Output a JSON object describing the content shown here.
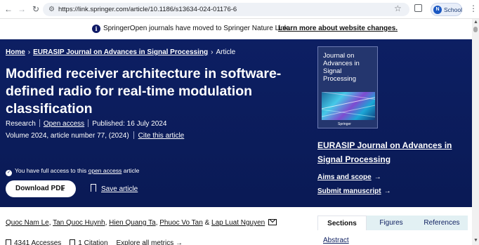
{
  "browser": {
    "url": "https://link.springer.com/article/10.1186/s13634-024-01176-6",
    "profile_initial": "N",
    "profile_label": "School"
  },
  "notice": {
    "text": "SpringerOpen journals have moved to Springer Nature Link.",
    "link": "Learn more about website changes."
  },
  "breadcrumb": {
    "home": "Home",
    "journal": "EURASIP Journal on Advances in Signal Processing",
    "current": "Article"
  },
  "article": {
    "title": "Modified receiver architecture in software-defined radio for real-time modulation classification",
    "type": "Research",
    "access": "Open access",
    "published": "Published: 16 July 2024",
    "volume": "Volume 2024, article number 77, (2024)",
    "cite": "Cite this article",
    "access_note_prefix": "You have full access to this",
    "access_note_link": "open access",
    "access_note_suffix": "article",
    "download_label": "Download PDF",
    "save_label": "Save article"
  },
  "journal": {
    "cover_line1": "Journal on",
    "cover_line2": "Advances in",
    "cover_line3": "Signal Processing",
    "cover_publisher": "Springer",
    "name": "EURASIP Journal on Advances in Signal Processing",
    "aims": "Aims and scope",
    "submit": "Submit manuscript"
  },
  "authors": [
    "Quoc Nam Le",
    "Tan Quoc Huynh",
    "Hien Quang Ta",
    "Phuoc Vo Tan",
    "Lap Luat Nguyen"
  ],
  "metrics": {
    "accesses": "4341 Accesses",
    "citations": "1 Citation",
    "explore": "Explore all metrics"
  },
  "tabs": [
    "Sections",
    "Figures",
    "References"
  ],
  "sections": [
    "Abstract"
  ]
}
